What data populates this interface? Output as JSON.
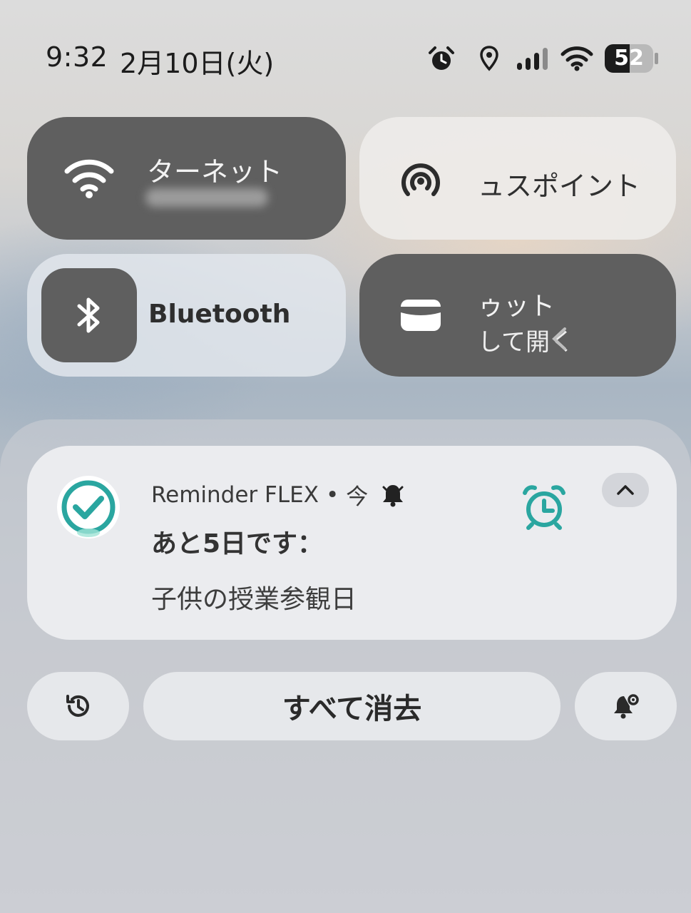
{
  "status_bar": {
    "time": "9:32",
    "date": "2月10日(火)",
    "battery_level": "52",
    "icons": [
      "alarm-icon",
      "location-icon",
      "cellular-signal-icon",
      "wifi-icon",
      "battery-icon"
    ]
  },
  "quick_settings": {
    "internet": {
      "label": "ターネット",
      "icon": "wifi-icon"
    },
    "hotspot": {
      "label": "ュスポイント",
      "icon": "hotspot-icon"
    },
    "bluetooth": {
      "label": "Bluetooth",
      "icon": "bluetooth-icon"
    },
    "wallet": {
      "label_line1": "ゥット",
      "label_line2": "して開く",
      "icon": "wallet-card-icon"
    }
  },
  "notification": {
    "app_name": "Reminder FLEX",
    "separator": "•",
    "time": "今",
    "title": "あと5日です：",
    "body": "子供の授業参観日",
    "accent_color": "#2aa6a0"
  },
  "actions": {
    "clear_all_label": "すべて消去"
  }
}
